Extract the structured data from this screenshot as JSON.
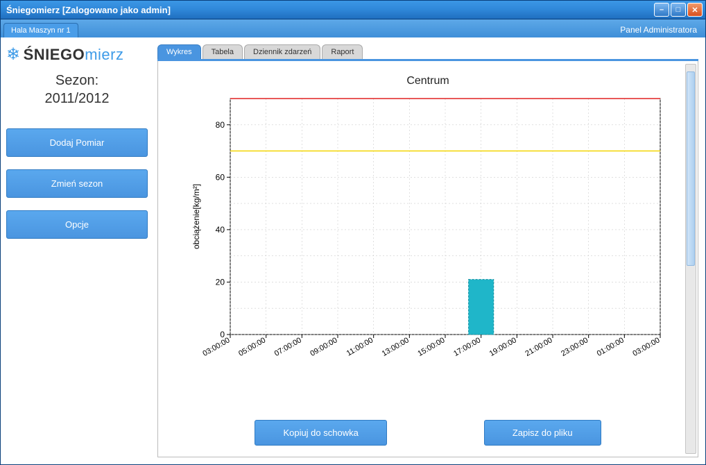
{
  "window": {
    "title": "Śniegomierz [Zalogowano jako admin]"
  },
  "appbar": {
    "tab_label": "Hala Maszyn nr 1",
    "panel_admin": "Panel Administratora"
  },
  "logo": {
    "part1": "ŚNIEGO",
    "part2": "mierz"
  },
  "sidebar": {
    "season_line1": "Sezon:",
    "season_line2": "2011/2012",
    "add_measure": "Dodaj Pomiar",
    "change_season": "Zmień sezon",
    "options": "Opcje"
  },
  "tabs": {
    "wykres": "Wykres",
    "tabela": "Tabela",
    "dziennik": "Dziennik zdarzeń",
    "raport": "Raport"
  },
  "buttons": {
    "copy": "Kopiuj do schowka",
    "save": "Zapisz do pliku"
  },
  "chart_data": {
    "type": "bar",
    "title": "Centrum",
    "ylabel": "obciążenie[kg/m²]",
    "ylim": [
      0,
      90
    ],
    "yticks": [
      0,
      20,
      40,
      60,
      80
    ],
    "categories": [
      "03:00:00",
      "05:00:00",
      "07:00:00",
      "09:00:00",
      "11:00:00",
      "13:00:00",
      "15:00:00",
      "17:00:00",
      "19:00:00",
      "21:00:00",
      "23:00:00",
      "01:00:00",
      "03:00:00"
    ],
    "values": [
      0,
      0,
      0,
      0,
      0,
      0,
      0,
      21,
      0,
      0,
      0,
      0,
      0,
      0
    ],
    "reference_lines": [
      {
        "value": 70,
        "color": "#f2d400"
      },
      {
        "value": 90,
        "color": "#e02020"
      }
    ]
  }
}
